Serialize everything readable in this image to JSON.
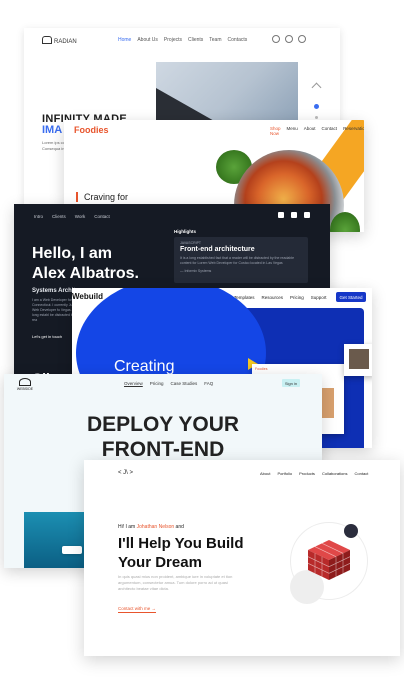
{
  "radian": {
    "brand": "RADIAN",
    "nav": [
      "Home",
      "About Us",
      "Projects",
      "Clients",
      "Team",
      "Contacts"
    ],
    "title_line1": "INFINITY MADE",
    "title_line2": "IMA",
    "paragraph": "Lorem ips consectet Consequa interdum"
  },
  "foodies": {
    "brand": "Foodies",
    "nav": [
      "Shop Now",
      "Menu",
      "About",
      "Contact",
      "Reservation"
    ],
    "headline": "Craving for"
  },
  "alex": {
    "nav": [
      "Intro",
      "Clients",
      "Work",
      "Contact"
    ],
    "highlights_label": "Highlights",
    "highlight_kicker": "JAVASCRIPT",
    "highlight_title": "Front-end architecture",
    "highlight_desc": "It is a long established fact that a reader will be distracted by the readable content for Lorem Web Developer for Costco located in Las Vegas",
    "highlight_meta": "— Informix Systems",
    "hello_line1": "Hello, I am",
    "hello_line2": "Alex Albatros.",
    "subtitle": "Systems Archit",
    "bio": "I am a Web Developer for Connecticut. I currently Junior Web Developer fo Vegas. It is a long establ be distracted by the rea",
    "cta": "Let's get in touch",
    "footer_partial": "Cli"
  },
  "webuild": {
    "brand": "Webuild",
    "nav": [
      "Templates",
      "Resources",
      "Pricing",
      "Support"
    ],
    "cta": "Get Started",
    "hero_text": "Creating",
    "mini_brand": "Foodies"
  },
  "deploy": {
    "brand": "WEBSIDE",
    "nav": [
      "Overview",
      "Pricing",
      "Case Studies",
      "FAQ"
    ],
    "signin": "Sign in",
    "headline_line1": "DEPLOY YOUR",
    "headline_line2": "FRONT-END"
  },
  "johathan": {
    "brand": "< J\\ >",
    "nav": [
      "About",
      "Portfolio",
      "Products",
      "Collaborations",
      "Contact"
    ],
    "hi_prefix": "Hi! I am",
    "hi_name": "Johathan Nelson",
    "hi_suffix": "and",
    "headline_line1": "I'll Help You Build",
    "headline_line2": "Your Dream",
    "paragraph": "In quis quasi mius non proident, ambique iure in voluptate et tion argumentum, consectetur amua. Tum dolore porro ad ut quasi architecto beatae vitae dicta.",
    "contact": "Contact with me  →"
  },
  "colors": {
    "foodies_accent": "#e8552d",
    "webuild_blue": "#1637c8",
    "radian_blue": "#3a6df0",
    "alex_bg": "#151a24",
    "deploy_bg": "#f2f8fa"
  }
}
